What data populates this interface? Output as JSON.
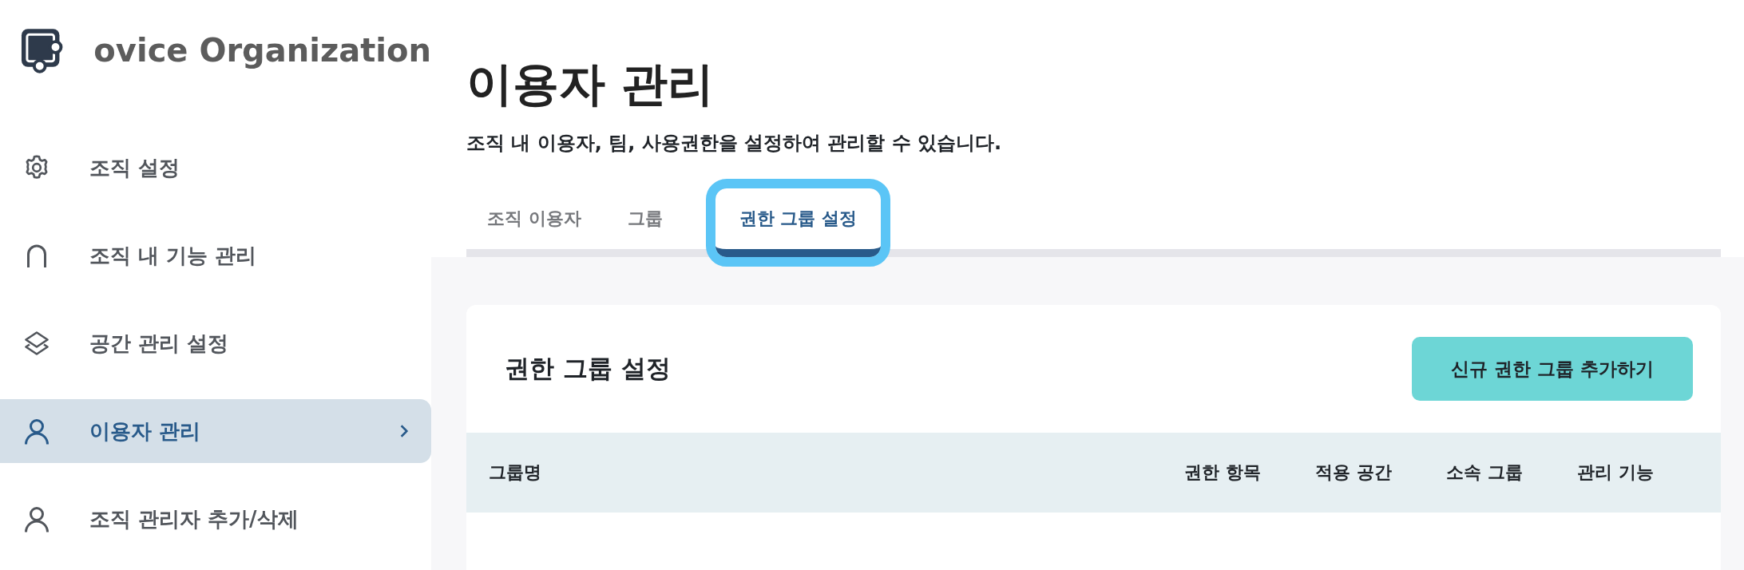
{
  "sidebar": {
    "title": "ovice Organization",
    "items": [
      {
        "label": "조직 설정",
        "selected": false
      },
      {
        "label": "조직 내 기능 관리",
        "selected": false
      },
      {
        "label": "공간 관리 설정",
        "selected": false
      },
      {
        "label": "이용자 관리",
        "selected": true
      },
      {
        "label": "조직 관리자 추가/삭제",
        "selected": false
      }
    ]
  },
  "page": {
    "title": "이용자 관리",
    "subtitle": "조직 내 이용자, 팀, 사용권한을 설정하여 관리할 수 있습니다."
  },
  "tabs": [
    {
      "label": "조직 이용자",
      "selected": false,
      "highlighted": false
    },
    {
      "label": "그룹",
      "selected": false,
      "highlighted": false
    },
    {
      "label": "권한 그룹 설정",
      "selected": true,
      "highlighted": true
    }
  ],
  "panel": {
    "title": "권한 그룹 설정",
    "button": "신규 권한 그룹 추가하기",
    "table": {
      "columns": [
        "그룹명",
        "권한 항목",
        "적용 공간",
        "소속 그룹",
        "관리 기능"
      ]
    }
  }
}
